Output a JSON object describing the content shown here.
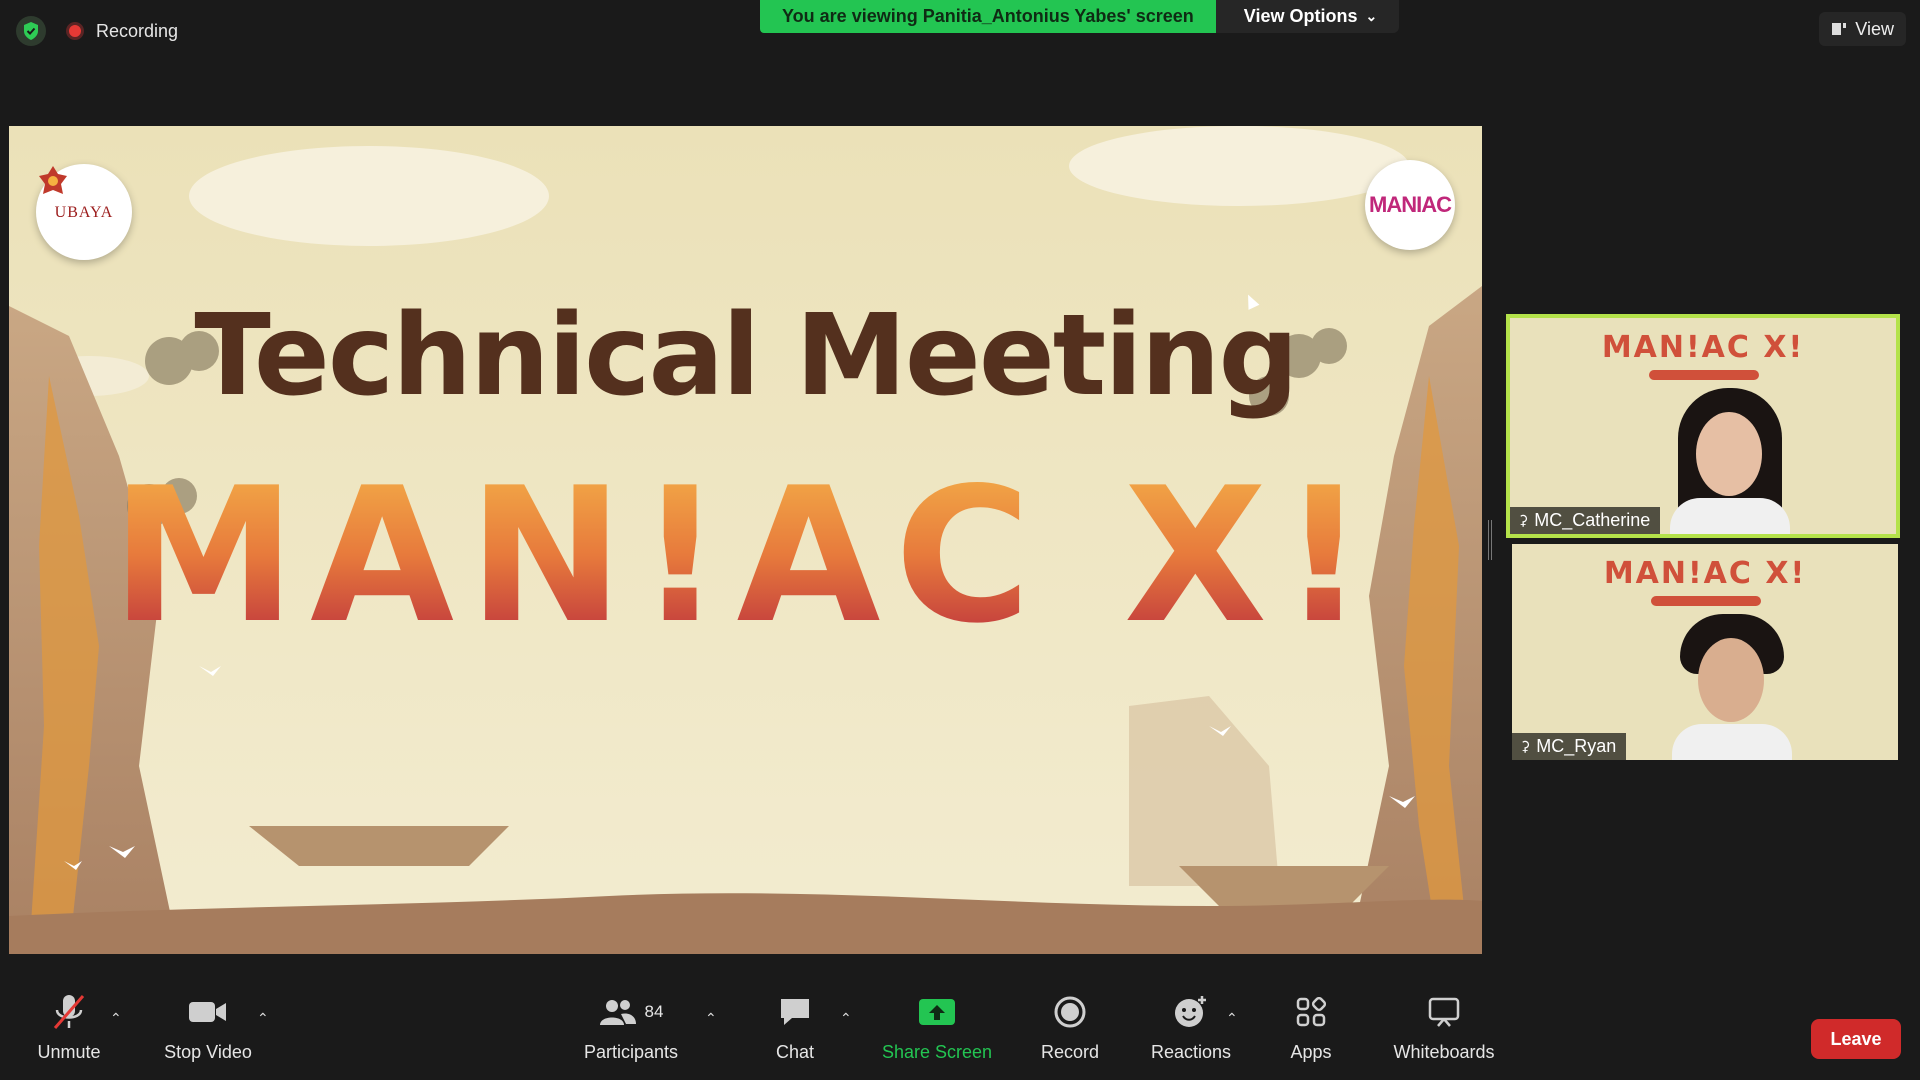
{
  "top": {
    "recording_label": "Recording",
    "banner_text": "You are viewing Panitia_Antonius Yabes' screen",
    "view_options_label": "View Options",
    "view_label": "View"
  },
  "shared_screen": {
    "title": "Technical Meeting",
    "event_name": "MAN!AC X!",
    "logo_left_text": "UBAYA",
    "logo_right_text": "MANIAC"
  },
  "participants": [
    {
      "name": "MC_Catherine",
      "banner": "MAN!AC X!"
    },
    {
      "name": "MC_Ryan",
      "banner": "MAN!AC X!"
    }
  ],
  "toolbar": {
    "unmute_label": "Unmute",
    "stop_video_label": "Stop Video",
    "participants_label": "Participants",
    "participants_count": "84",
    "chat_label": "Chat",
    "share_screen_label": "Share Screen",
    "record_label": "Record",
    "reactions_label": "Reactions",
    "apps_label": "Apps",
    "whiteboards_label": "Whiteboards",
    "leave_label": "Leave"
  },
  "colors": {
    "banner_green": "#23c552",
    "leave_red": "#d02a2a",
    "active_speaker_outline": "#b4e24a"
  }
}
